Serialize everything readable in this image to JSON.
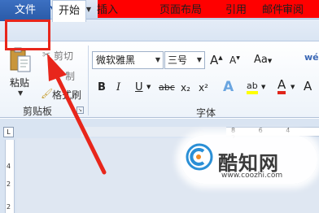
{
  "quick_access": {
    "app_icon": "W",
    "save_icon": "save-icon",
    "undo_icon": "undo-icon",
    "redo_icon": "redo-icon"
  },
  "tabs": {
    "file": "文件",
    "home": "开始",
    "insert": "插入",
    "page_layout": "页面布局",
    "references": "引用",
    "mailings": "邮件",
    "review": "审阅"
  },
  "clipboard": {
    "paste": "粘贴",
    "cut": "剪切",
    "copy": "复制",
    "copy_visible": "制",
    "format_painter": "格式刷",
    "group_label": "剪贴板"
  },
  "font_group": {
    "font_name": "微软雅黑",
    "font_size": "三号",
    "grow": "A",
    "shrink": "A",
    "change_case": "Aa",
    "bold": "B",
    "italic": "I",
    "underline": "U",
    "strikethrough": "abc",
    "subscript": "x₂",
    "superscript": "x²",
    "text_effect": "A",
    "highlight": "ab",
    "font_color": "A",
    "group_label": "字体"
  },
  "ruler": {
    "h_numbers": "8 6 4 2",
    "v_numbers": [
      "4",
      "2",
      "2"
    ]
  },
  "watermark": {
    "title": "酷知网",
    "url": "www.coozhi.com"
  },
  "colors": {
    "file_tab": "#2a5aa8",
    "annotation_red": "#e8261b",
    "title_bar_red": "#ff0000"
  }
}
